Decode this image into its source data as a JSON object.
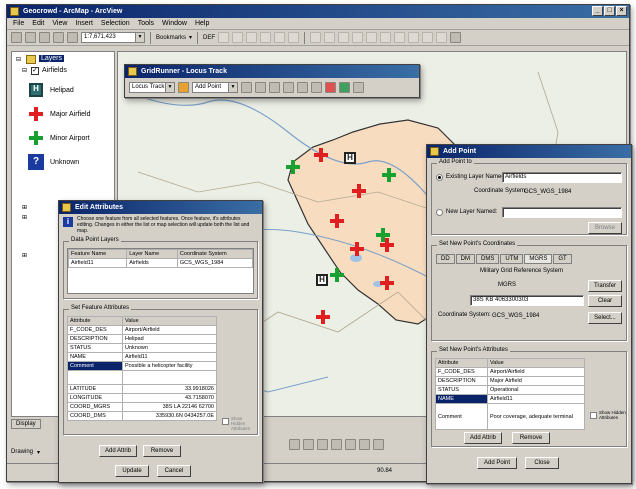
{
  "app": {
    "title": "Geocrowd - ArcMap - ArcView",
    "menu": [
      "File",
      "Edit",
      "View",
      "Insert",
      "Selection",
      "Tools",
      "Window",
      "Help"
    ],
    "scale": "1:7,671,423",
    "bookmarks_label": "Bookmarks",
    "toolbar2_label": "DEF"
  },
  "toc": {
    "root": "Layers",
    "layer": "Airfields",
    "legend": [
      {
        "label": "Helipad",
        "icon": "helipad-icon"
      },
      {
        "label": "Major Airfield",
        "icon": "red-plus-icon"
      },
      {
        "label": "Minor Airport",
        "icon": "green-plus-icon"
      },
      {
        "label": "Unknown",
        "icon": "question-mark-icon"
      }
    ],
    "tabs": [
      "Display"
    ],
    "drawing_label": "Drawing"
  },
  "gridrunner": {
    "title": "GridRunner - Locus Track",
    "combo1": "Locus Track",
    "combo2": "Add Point"
  },
  "status": {
    "coords": "90.84"
  },
  "edit_attr": {
    "title": "Edit Attributes",
    "instructions": "Choose one feature from all selected features. Once feature, it's attributes editing. Changes in either the list or map selection will update both the list and map.",
    "features_group": "Data Point Layers",
    "feature_columns": [
      "Feature Name",
      "Layer Name",
      "Coordinate System"
    ],
    "feature_row": [
      "Airfield11",
      "Airfields",
      "GCS_WGS_1984"
    ],
    "attr_group": "Set Feature Attributes",
    "attr_columns": [
      "Attribute",
      "Value"
    ],
    "rows": [
      [
        "F_CODE_DES",
        "Airport/Airfield"
      ],
      [
        "DESCRIPTION",
        "Helipad"
      ],
      [
        "STATUS",
        "Unknown"
      ],
      [
        "NAME",
        "Airfield11"
      ],
      [
        "Comment",
        "Possible a helicopter facility"
      ],
      [
        "",
        ""
      ],
      [
        "LATITUDE",
        "33.9918026"
      ],
      [
        "LONGITUDE",
        "43.7158070"
      ],
      [
        "COORD_MGRS",
        "38S LA 22146 62700"
      ],
      [
        "COORD_DMS",
        "335930.6N 0434257.0E"
      ]
    ],
    "selected_row": 4,
    "add_attr": "Add Attrib",
    "remove": "Remove",
    "show_hidden": "Show Hidden Attributes",
    "update": "Update",
    "cancel": "Cancel"
  },
  "add_point": {
    "title": "Add Point",
    "add_point_to": "Add Point to",
    "existing_label": "Existing Layer Named:",
    "existing_value": "Airfields",
    "coord_label": "Coordinate System:",
    "coord_value": "GCS_WGS_1984",
    "new_label": "New Layer Named:",
    "browse": "Browse",
    "coords_group": "Set New Point's Coordinates",
    "tabs": [
      "DD",
      "DM",
      "DMS",
      "UTM",
      "MGRS",
      "GT"
    ],
    "mgrs_system": "Military Grid Reference System",
    "mgrs_label": "MGRS",
    "mgrs_value": "38S KB 4063300303",
    "transfer": "Transfer",
    "clear": "Clear",
    "select": "Select...",
    "coord_system_value": "GCS_WGS_1984",
    "attr_group": "Set New Point's Attributes",
    "attr_columns": [
      "Attribute",
      "Value"
    ],
    "rows": [
      [
        "F_CODE_DES",
        "Airport/Airfield"
      ],
      [
        "DESCRIPTION",
        "Major Airfield"
      ],
      [
        "STATUS",
        "Operational"
      ],
      [
        "NAME",
        "Airfield11"
      ],
      [
        "Comment",
        "Poor coverage, adequate terminal"
      ]
    ],
    "selected_row": 3,
    "add_attr": "Add Attrib",
    "remove": "Remove",
    "show_hidden": "Show Hidden Attributes",
    "add_point_btn": "Add Point",
    "close": "Close"
  }
}
